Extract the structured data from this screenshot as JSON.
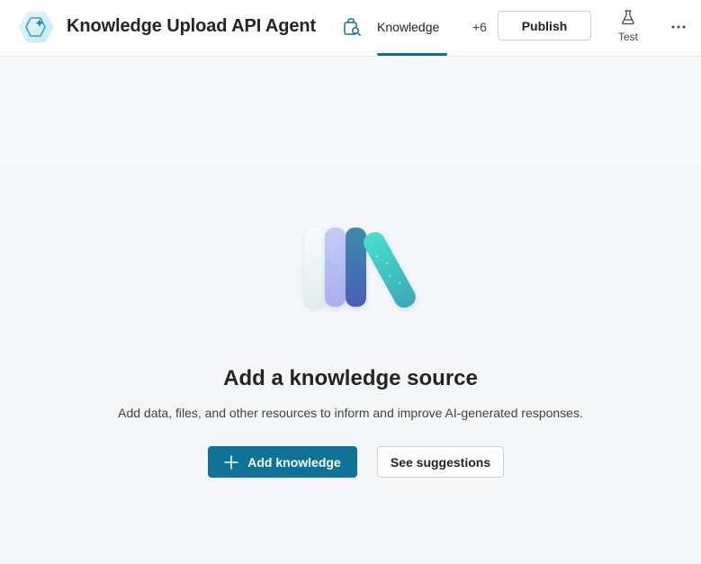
{
  "header": {
    "agent_title": "Knowledge Upload API Agent",
    "active_tab": "Knowledge",
    "more_tabs": "+6",
    "publish_label": "Publish",
    "test_label": "Test",
    "icons": {
      "agent_logo": "agent-hexagon-sparkle-icon",
      "tab": "knowledge-tab-icon",
      "test": "flask-icon",
      "overflow": "more-horizontal-icon"
    }
  },
  "main": {
    "empty_state_title": "Add a knowledge source",
    "empty_state_description": "Add data, files, and other resources to inform and improve AI-generated responses.",
    "primary_button_label": "Add knowledge",
    "secondary_button_label": "See suggestions",
    "illustration": "books-illustration"
  },
  "colors": {
    "accent": "#0f7399",
    "text": "#242424",
    "background": "#f5f7f9"
  }
}
